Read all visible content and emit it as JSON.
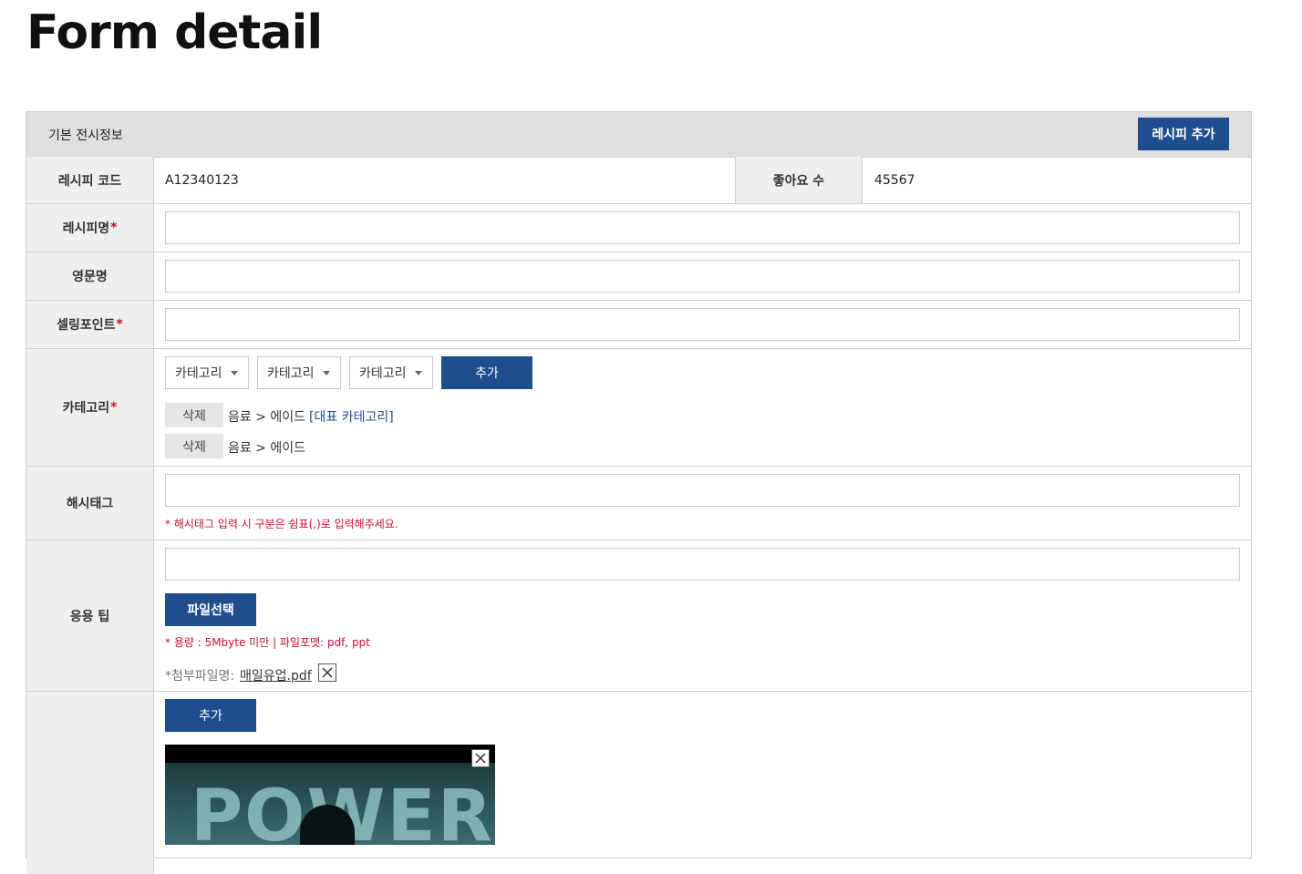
{
  "page": {
    "title": "Form detail"
  },
  "header": {
    "title": "기본 전시정보",
    "add_recipe_label": "레시피 추가"
  },
  "info_row": {
    "code_label": "레시피 코드",
    "code_value": "A12340123",
    "likes_label": "좋아요 수",
    "likes_value": "45567"
  },
  "fields": {
    "recipe_name_label": "레시피명",
    "english_name_label": "영문명",
    "selling_point_label": "셀링포인트",
    "category_label": "카테고리",
    "hashtag_label": "해시태그",
    "tip_label": "응용 팁",
    "required_mark": "*"
  },
  "category": {
    "selects": [
      "카테고리",
      "카테고리",
      "카테고리"
    ],
    "add_label": "추가",
    "items": [
      {
        "delete_label": "삭제",
        "path": "음료 > 에이드",
        "tag": "[대표 카테고리]"
      },
      {
        "delete_label": "삭제",
        "path": "음료 > 에이드",
        "tag": ""
      }
    ]
  },
  "hashtag": {
    "note": "* 해시태그 입력 시 구분은 쉼표(,)로 입력해주세요."
  },
  "tip": {
    "file_button": "파일선택",
    "note": "* 용량 : 5Mbyte 미만 | 파일포맷: pdf, ppt",
    "attach_label": "*첨부파일명:",
    "attach_file": "매일유업.pdf"
  },
  "media": {
    "add_label": "추가",
    "image_text": "POWER"
  },
  "colors": {
    "accent": "#1f4e8f",
    "required": "#c8102e",
    "header_bg": "#dfdfdf",
    "label_bg": "#efefef"
  }
}
